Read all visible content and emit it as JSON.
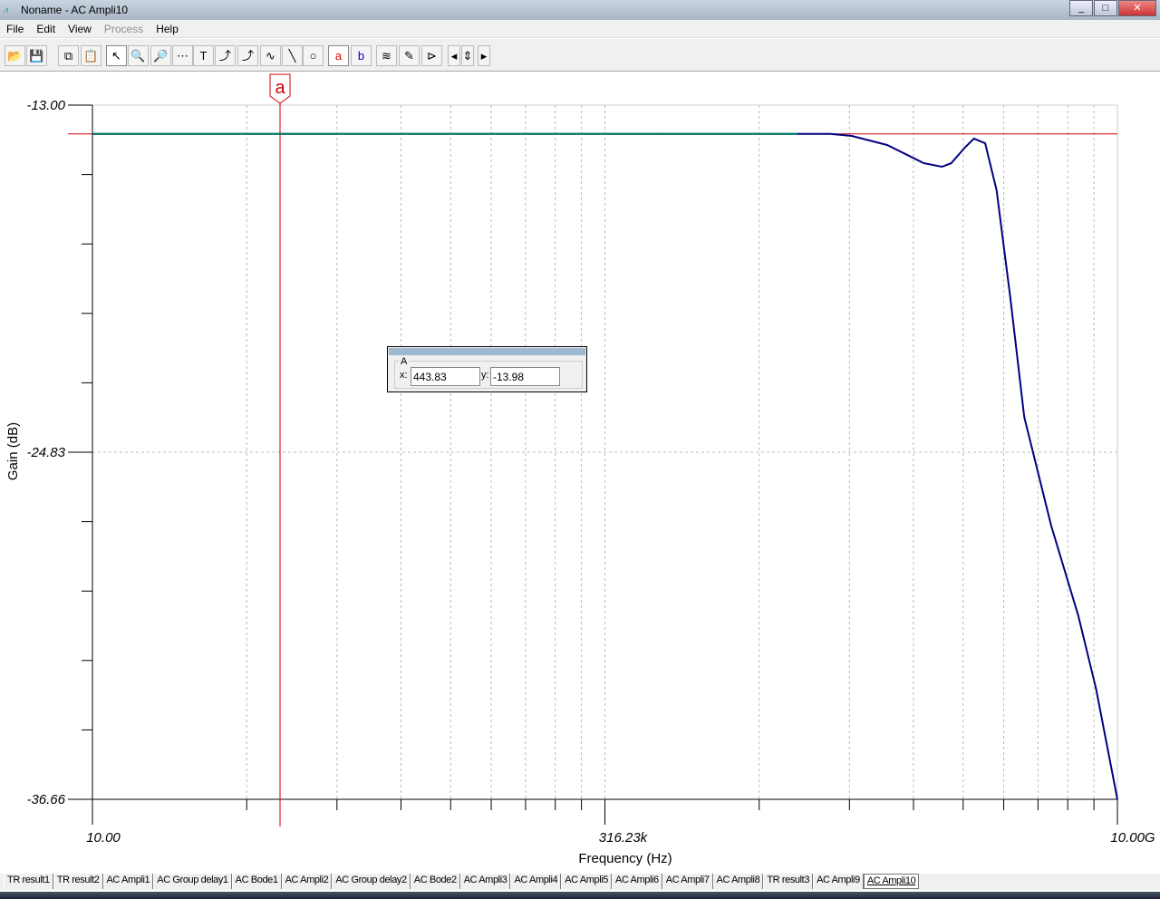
{
  "window": {
    "title": "Noname - AC Ampli10",
    "controls": [
      "_",
      "□",
      "✕"
    ]
  },
  "menu": [
    {
      "label": "File"
    },
    {
      "label": "Edit"
    },
    {
      "label": "View"
    },
    {
      "label": "Process",
      "disabled": true
    },
    {
      "label": "Help"
    }
  ],
  "toolbar": [
    {
      "name": "open-icon",
      "glyph": "📂"
    },
    {
      "name": "save-icon",
      "glyph": "💾"
    },
    {
      "name": "copy-icon",
      "glyph": "⧉"
    },
    {
      "name": "paste-icon",
      "glyph": "📋"
    },
    {
      "name": "select-arrow-icon",
      "glyph": "↖",
      "active": true
    },
    {
      "name": "zoom-in-icon",
      "glyph": "🔍"
    },
    {
      "name": "zoom-100-icon",
      "glyph": "🔎"
    },
    {
      "name": "grid-icon",
      "glyph": "⋯"
    },
    {
      "name": "text-icon",
      "glyph": "T"
    },
    {
      "name": "curve-label-icon",
      "glyph": "⤴"
    },
    {
      "name": "curve-query-icon",
      "glyph": "⤴"
    },
    {
      "name": "curve-formula-icon",
      "glyph": "∿"
    },
    {
      "name": "line-icon",
      "glyph": "╲"
    },
    {
      "name": "circle-icon",
      "glyph": "○"
    },
    {
      "name": "cursor-a-icon",
      "glyph": "a",
      "active": true
    },
    {
      "name": "cursor-b-icon",
      "glyph": "b"
    },
    {
      "name": "add-curve-icon",
      "glyph": "≋"
    },
    {
      "name": "add-marker-icon",
      "glyph": "✎"
    },
    {
      "name": "flag-icon",
      "glyph": "⊳"
    },
    {
      "name": "arrow-left-icon",
      "glyph": "◂"
    },
    {
      "name": "arrow-updown-icon",
      "glyph": "⇕"
    },
    {
      "name": "arrow-right-icon",
      "glyph": "▸"
    }
  ],
  "cursor_box": {
    "legend": "A",
    "x_label": "x:",
    "x_value": "443.83",
    "y_label": "y:",
    "y_value": "-13.98"
  },
  "tabs": [
    "TR result1",
    "TR result2",
    "AC Ampli1",
    "AC Group delay1",
    "AC Bode1",
    "AC Ampli2",
    "AC Group delay2",
    "AC Bode2",
    "AC Ampli3",
    "AC Ampli4",
    "AC Ampli5",
    "AC Ampli6",
    "AC Ampli7",
    "AC Ampli8",
    "TR result3",
    "AC Ampli9",
    "AC Ampli10"
  ],
  "active_tab": "AC Ampli10",
  "chart_data": {
    "type": "line",
    "xlabel": "Frequency (Hz)",
    "ylabel": "Gain (dB)",
    "xscale": "log",
    "xlim": [
      10,
      10000000000
    ],
    "ylim": [
      -36.66,
      -13.0
    ],
    "x_tick_labels": [
      "10.00",
      "316.23k",
      "10.00G"
    ],
    "y_tick_labels": [
      "-13.00",
      "-24.83",
      "-36.66"
    ],
    "grid": true,
    "cursor": {
      "label": "a",
      "x": 443.83,
      "y": -13.98,
      "color": "#d00000"
    },
    "series": [
      {
        "name": "Gain",
        "color": "#000080",
        "flat_color": "#008060",
        "x": [
          10,
          1000000,
          30000000,
          46500000,
          95000000,
          200000000,
          288000000,
          347000000,
          457000000,
          550000000,
          690000000,
          870000000,
          1150000000,
          1520000000,
          2620000000,
          4550000000,
          6500000000,
          10000000000
        ],
        "y": [
          -13.98,
          -13.98,
          -13.98,
          -14.05,
          -14.36,
          -14.98,
          -15.1,
          -14.98,
          -14.45,
          -14.14,
          -14.3,
          -15.9,
          -19.6,
          -23.63,
          -27.33,
          -30.42,
          -32.9,
          -36.66
        ]
      }
    ]
  }
}
